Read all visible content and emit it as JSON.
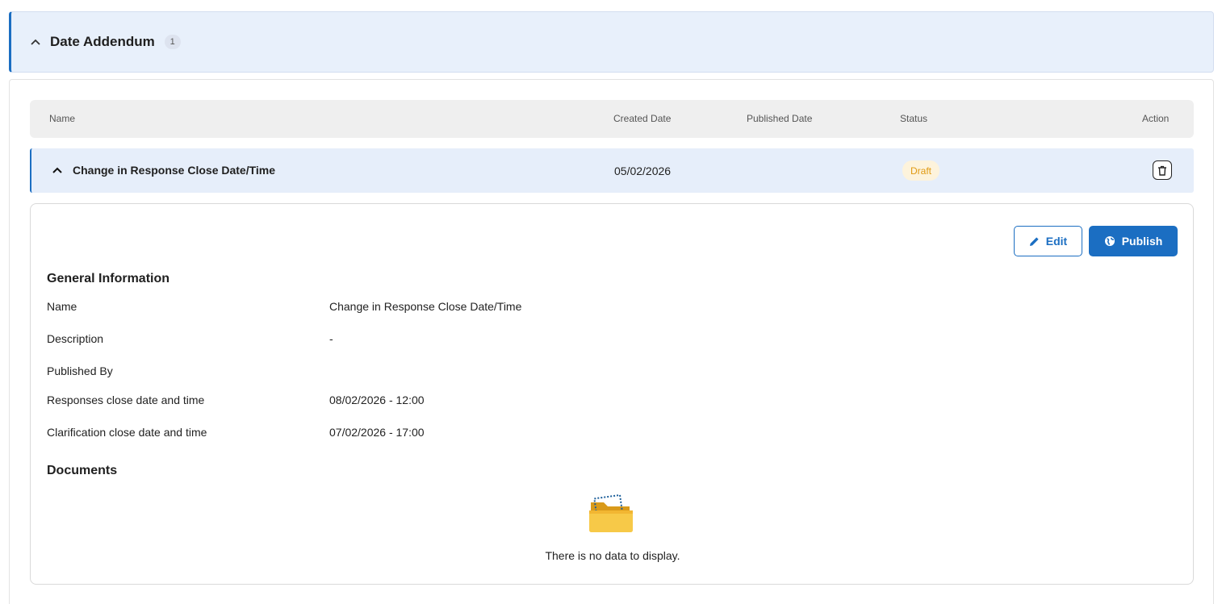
{
  "section": {
    "title": "Date Addendum",
    "count": "1"
  },
  "table": {
    "columns": {
      "name": "Name",
      "created": "Created Date",
      "published": "Published Date",
      "status": "Status",
      "action": "Action"
    },
    "row": {
      "name": "Change in Response Close Date/Time",
      "created": "05/02/2026",
      "published": "",
      "status": "Draft"
    }
  },
  "detail": {
    "edit_label": "Edit",
    "publish_label": "Publish",
    "general_title": "General Information",
    "fields": [
      {
        "label": "Name",
        "value": "Change in Response Close Date/Time"
      },
      {
        "label": "Description",
        "value": "-"
      },
      {
        "label": "Published By",
        "value": ""
      },
      {
        "label": "Responses close date and time",
        "value": "08/02/2026 - 12:00"
      },
      {
        "label": "Clarification close date and time",
        "value": "07/02/2026 - 17:00"
      }
    ],
    "documents_title": "Documents",
    "empty_text": "There is no data to display."
  },
  "colors": {
    "accent": "#1b6ec2",
    "draft_text": "#e09a12",
    "draft_bg": "#fdf3dc"
  },
  "icons": {
    "collapse": "chevron-up-icon",
    "delete": "trash-icon",
    "edit": "pencil-icon",
    "publish": "globe-icon",
    "empty": "folder-icon"
  }
}
